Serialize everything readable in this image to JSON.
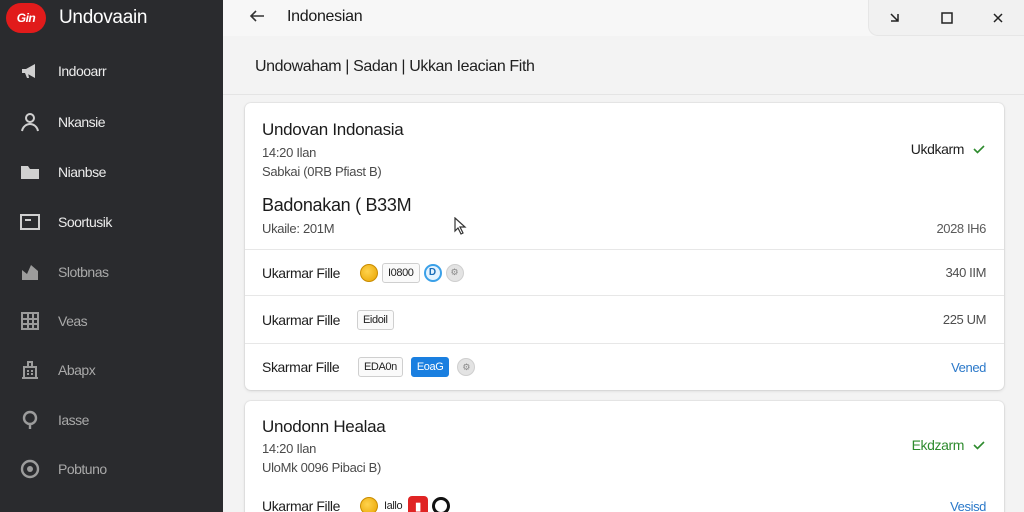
{
  "app": {
    "name": "Undovaain",
    "logo_text": "Gin"
  },
  "sidebar": {
    "items": [
      {
        "label": "Indooarr",
        "icon": "megaphone-icon"
      },
      {
        "label": "Nkansie",
        "icon": "person-icon"
      },
      {
        "label": "Nianbse",
        "icon": "folder-icon"
      },
      {
        "label": "Soortusik",
        "icon": "window-icon"
      },
      {
        "label": "Slotbnas",
        "icon": "chart-icon"
      },
      {
        "label": "Veas",
        "icon": "grid-icon"
      },
      {
        "label": "Abapx",
        "icon": "building-icon"
      },
      {
        "label": "Iasse",
        "icon": "lightbulb-icon"
      },
      {
        "label": "Pobtuno",
        "icon": "record-icon"
      }
    ]
  },
  "titlebar": {
    "title": "Indonesian"
  },
  "breadcrumb": "Undowaham  | Sadan | Ukkan  Ieacian Fith",
  "cards": [
    {
      "title": "Undovan Indonasia",
      "sub1": "14:20 Ilan",
      "sub2": "Sabkai (0RB Pfiast B)",
      "status": "Ukdkarm",
      "big": "Badonakan ( B33M",
      "small": "Ukaile: 201M",
      "right": "2028 IH6",
      "rows": [
        {
          "label": "Ukarmar Fille",
          "chip_text": "I0800",
          "value": "340 IIM"
        },
        {
          "label": "Ukarmar Fille",
          "chip_text": "Eidoil",
          "value": "225 UM"
        },
        {
          "label": "Skarmar Fille",
          "chip_text": "EDA0n",
          "chip_blue": "EoaG",
          "value": "Vened"
        }
      ]
    },
    {
      "title": "Unodonn Healaa",
      "sub1": "14:20 Ilan",
      "sub2": "UloMk 0096 Pibaci B)",
      "status": "Ekdzarm",
      "rows": [
        {
          "label": "Ukarmar Fille",
          "chip_text": "Iallo",
          "value": "Vesisd"
        }
      ]
    }
  ],
  "colors": {
    "sidebar_bg": "#2a2b2e",
    "accent_green": "#2e8b2e",
    "link_blue": "#2a78c9",
    "logo_red": "#e11b1b"
  }
}
